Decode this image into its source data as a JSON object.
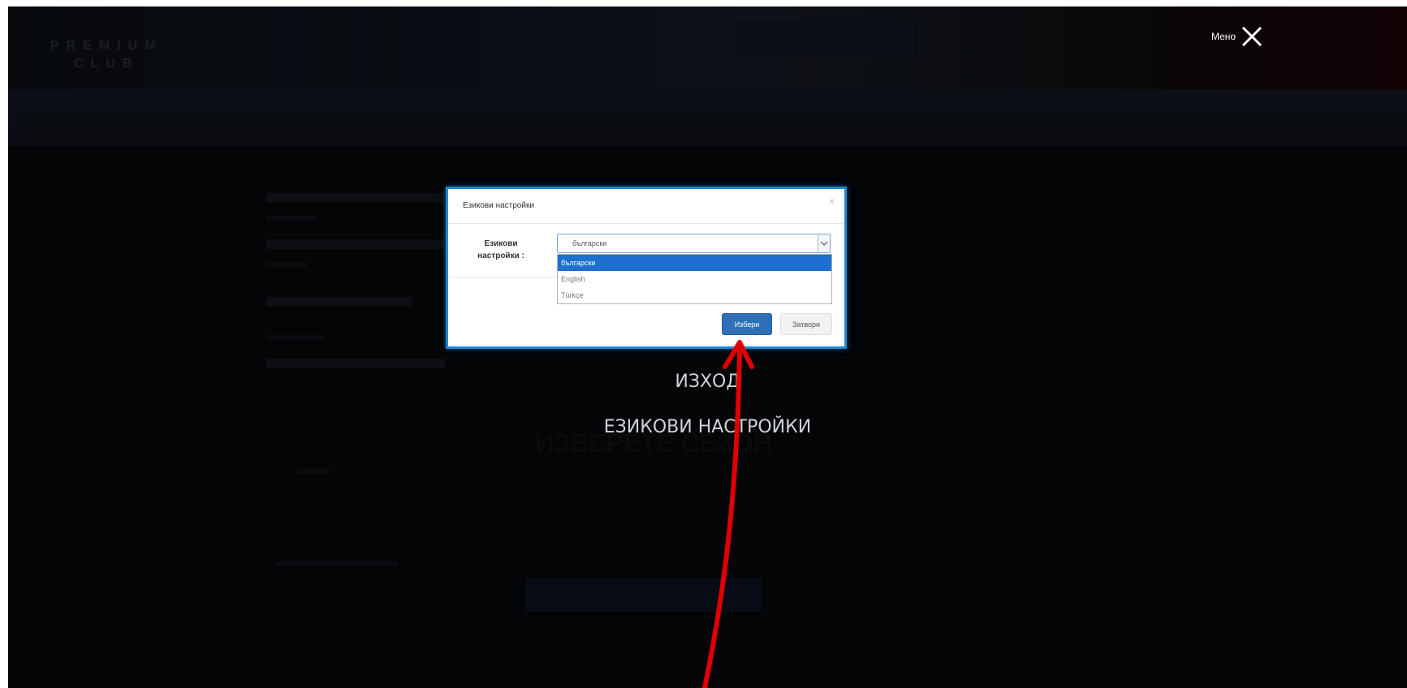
{
  "header": {
    "logo_line1": "PREMIUM",
    "logo_line2": "CLUB",
    "menu_label": "Мено",
    "close_icon": "close-icon"
  },
  "menu": {
    "logout": "ИЗХОД",
    "language_settings": "ЕЗИКОВИ НАСТРОЙКИ"
  },
  "background": {
    "dim_heading": "ИЗБЕРЕТЕ СЕЗОН"
  },
  "modal": {
    "title": "Езикови настройки",
    "close": "×",
    "field_label_line1": "Езикови",
    "field_label_line2": "настройки :",
    "selected_value": "български",
    "options": [
      "български",
      "English",
      "Türkçe"
    ],
    "select_button": "Избери",
    "close_button": "Затвори"
  },
  "colors": {
    "modal_border": "#1e88d0",
    "primary_button": "#2f6fb7",
    "selected_option": "#1e6fd0",
    "annotation_arrow": "#e00000"
  }
}
